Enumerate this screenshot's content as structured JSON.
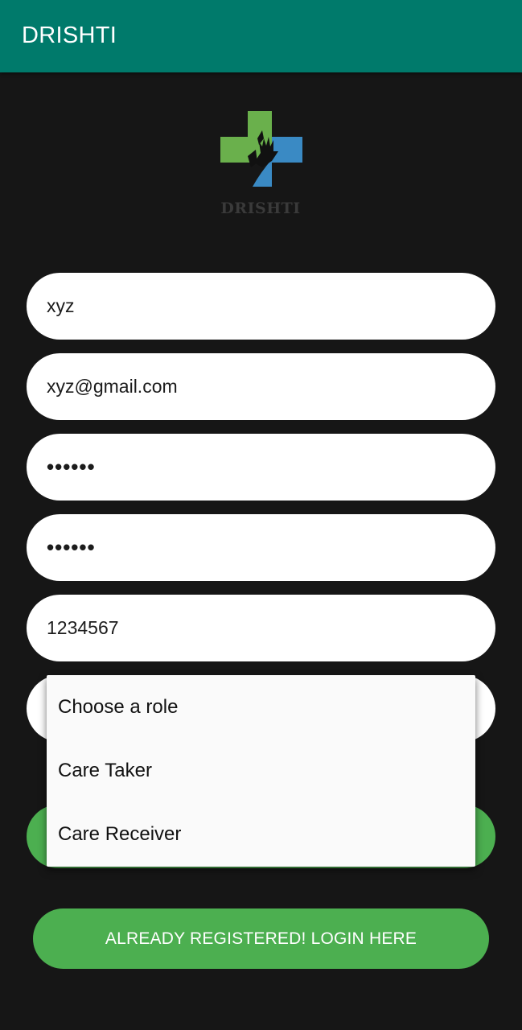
{
  "app": {
    "title": "DRISHTI"
  },
  "logo": {
    "text": "DRISHTI",
    "colors": {
      "green": "#6ab04c",
      "blue": "#3a8ac4"
    }
  },
  "form": {
    "name_value": "xyz",
    "email_value": "xyz@gmail.com",
    "password_value": "••••••",
    "confirm_password_value": "••••••",
    "phone_value": "1234567",
    "role_options": [
      "Choose a role",
      "Care Taker",
      "Care Receiver"
    ]
  },
  "actions": {
    "login_label": "ALREADY REGISTERED! LOGIN HERE"
  },
  "colors": {
    "app_bar": "#007a6b",
    "background": "#161616",
    "button": "#4caf50"
  }
}
